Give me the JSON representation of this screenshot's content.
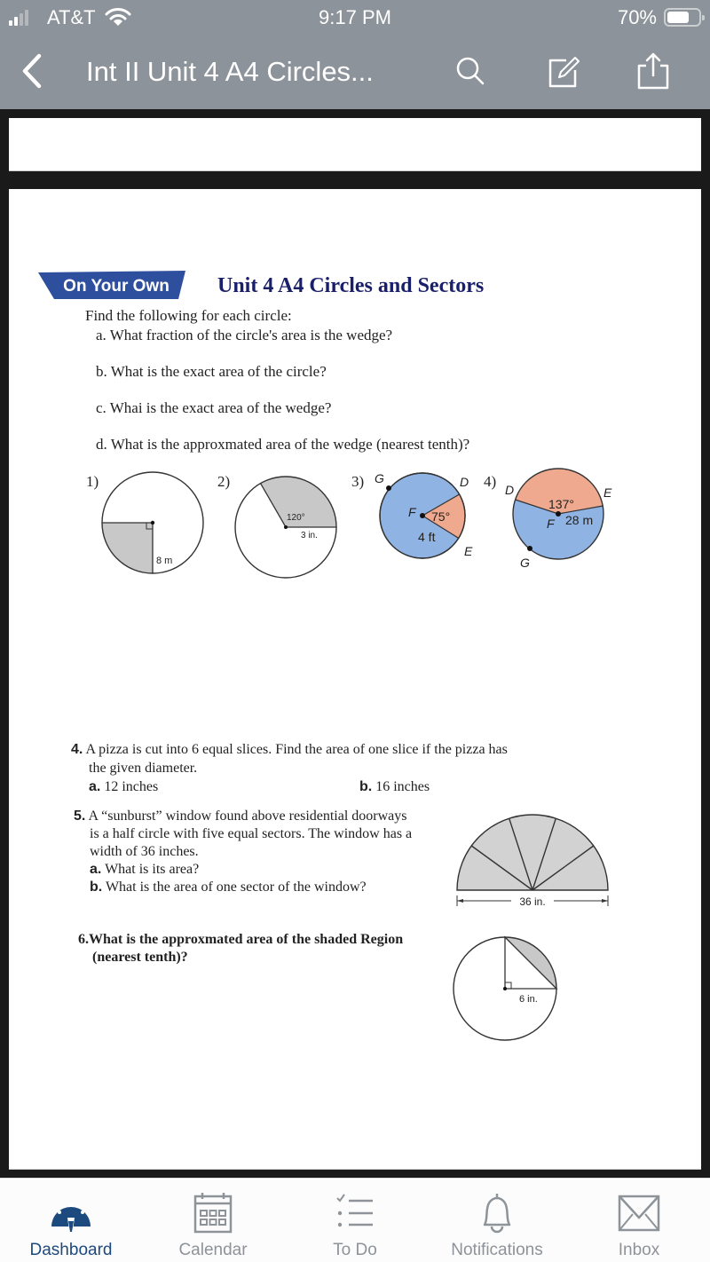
{
  "status_bar": {
    "carrier": "AT&T",
    "time": "9:17 PM",
    "battery_percent_label": "70%",
    "battery_level": 0.7,
    "signal_bars": 2
  },
  "nav": {
    "title": "Int II Unit 4 A4 Circles...",
    "icons": [
      "back-chevron-icon",
      "search-icon",
      "annotate-icon",
      "share-icon"
    ]
  },
  "document": {
    "badge": "On Your Own",
    "title": "Unit 4 A4 Circles and Sectors",
    "intro": "Find the following for each circle:",
    "questions": [
      "a. What fraction of the circle's area is the wedge?",
      "b. What is the exact area of the circle?",
      "c. Whai is the exact area of the wedge?",
      "d. What is the approxmated area of the wedge (nearest tenth)?"
    ],
    "figures": [
      {
        "label": "1)",
        "measure": "8 m"
      },
      {
        "label": "2)",
        "angle": "120°",
        "measure": "3 in."
      },
      {
        "label": "3)",
        "points": [
          "G",
          "D",
          "F",
          "E"
        ],
        "angle": "75°",
        "measure": "4 ft"
      },
      {
        "label": "4)",
        "points": [
          "D",
          "E",
          "F",
          "G"
        ],
        "angle": "137°",
        "measure": "28 m"
      }
    ],
    "problem4": {
      "number": "4.",
      "line1": "A pizza is cut into 6 equal slices. Find the area of one slice if the pizza has",
      "line2": "the given diameter.",
      "a_label": "a.",
      "a_text": "12 inches",
      "b_label": "b.",
      "b_text": "16 inches"
    },
    "problem5": {
      "number": "5.",
      "lines": [
        "A “sunburst” window found above residential doorways",
        "is a half circle with five equal sectors. The window has a",
        "width of 36 inches."
      ],
      "a_label": "a.",
      "a_text": "What is its area?",
      "b_label": "b.",
      "b_text": "What is the area of one sector of the window?",
      "figure_measure": "36 in."
    },
    "problem6": {
      "line1": "6.What is the approxmated area of the shaded Region",
      "line2": "(nearest tenth)?",
      "figure_measure": "6 in."
    }
  },
  "tabbar": {
    "items": [
      {
        "label": "Dashboard",
        "icon": "dashboard-icon",
        "active": true
      },
      {
        "label": "Calendar",
        "icon": "calendar-icon",
        "active": false
      },
      {
        "label": "To Do",
        "icon": "todo-list-icon",
        "active": false
      },
      {
        "label": "Notifications",
        "icon": "bell-icon",
        "active": false
      },
      {
        "label": "Inbox",
        "icon": "envelope-icon",
        "active": false
      }
    ]
  },
  "colors": {
    "header_bg": "#8c939a",
    "badge_blue": "#2e4f9e",
    "title_navy": "#1a1f6b",
    "sector_blue": "#8fb3e3",
    "sector_orange": "#eea98e",
    "shade_gray": "#c8c8c8",
    "tab_active": "#1c4a7e",
    "tab_inactive": "#8e9399"
  }
}
